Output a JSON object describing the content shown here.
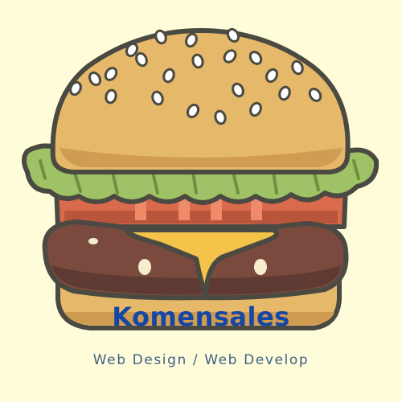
{
  "brand": {
    "name": "Komensales",
    "tagline": "Web Design / Web Develop"
  },
  "illustration": {
    "subject": "burger-icon"
  },
  "colors": {
    "background": "#fffdd9",
    "brand_text": "#1547a6",
    "tagline_text": "#3e5f86",
    "outline": "#4b4a42",
    "bun": "#e6b86a",
    "bun_shade": "#cf9c52",
    "sesame": "#ffffff",
    "lettuce": "#9fc266",
    "lettuce_shade": "#6f8f3e",
    "tomato": "#d96a4c",
    "cheese": "#f3c34a",
    "patty": "#7a4a3e",
    "patty_shade": "#5e3a32",
    "onion": "#f7edcf"
  }
}
